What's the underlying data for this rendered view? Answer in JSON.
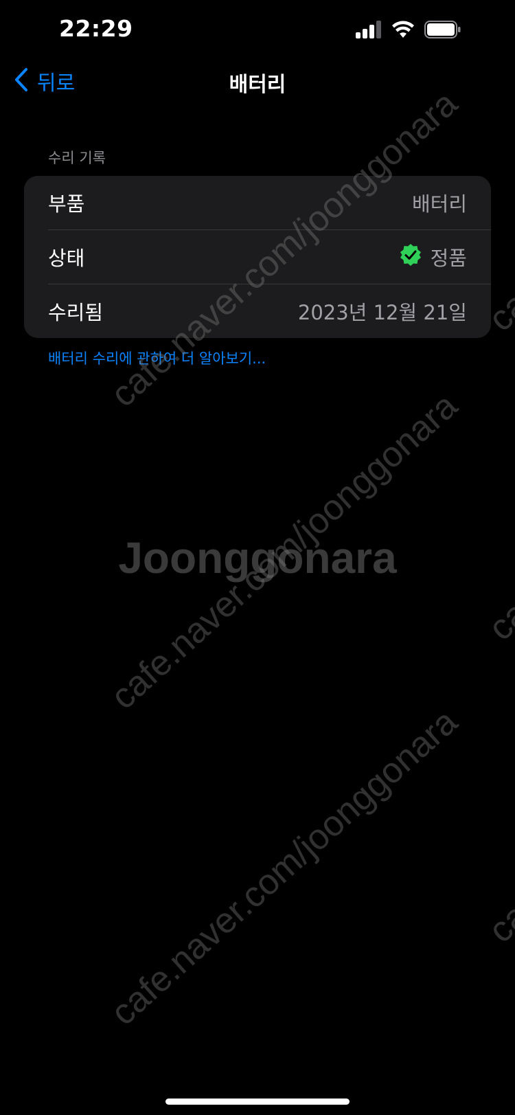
{
  "status_bar": {
    "time": "22:29",
    "icons": [
      "signal-icon",
      "wifi-icon",
      "battery-icon"
    ]
  },
  "nav": {
    "back_label": "뒤로",
    "title": "배터리"
  },
  "repair_history": {
    "section_title": "수리 기록",
    "rows": [
      {
        "label": "부품",
        "value": "배터리"
      },
      {
        "label": "상태",
        "value": "정품",
        "status_icon": "verified-check-icon"
      },
      {
        "label": "수리됨",
        "value": "2023년 12월 21일"
      }
    ],
    "learn_more_link": "배터리 수리에 관하여 더 알아보기..."
  },
  "watermark": {
    "logo": "Joonggonara",
    "text": "cafe.naver.com/joonggonara"
  },
  "colors": {
    "background": "#000000",
    "card": "#1c1c1e",
    "accent": "#0a84ff",
    "verified": "#30d158",
    "secondary_text": "#8e8e93"
  }
}
